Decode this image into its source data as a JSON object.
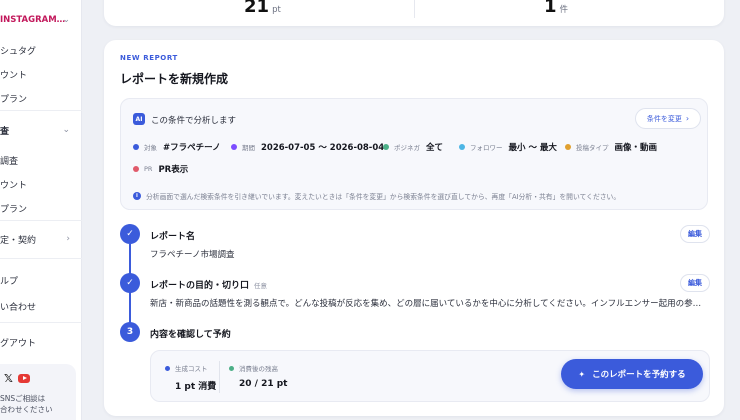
{
  "sidebar": {
    "brand": "INSTAGRAM…",
    "items": [
      {
        "label": "シュタグ"
      },
      {
        "label": "ウント"
      },
      {
        "label": "プラン"
      },
      {
        "label": "査"
      },
      {
        "label": "調査"
      },
      {
        "label": "ウント"
      },
      {
        "label": "プラン"
      },
      {
        "label": "定・契約"
      },
      {
        "label": "ルプ"
      },
      {
        "label": "い合わせ"
      },
      {
        "label": "グアウト"
      }
    ],
    "social": {
      "line1": "SNSご相談は",
      "line2": "合わせください"
    }
  },
  "stats": {
    "left": {
      "value": "21",
      "unit": "pt"
    },
    "right": {
      "value": "1",
      "unit": "件"
    }
  },
  "report": {
    "eyebrow": "NEW REPORT",
    "title": "レポートを新規作成",
    "conditions": {
      "ai_badge": "AI",
      "heading": "この条件で分析します",
      "change_label": "条件を変更",
      "chips": [
        {
          "label": "対象",
          "value": "#フラペチーノ",
          "color": "#3b5bdb"
        },
        {
          "label": "期間",
          "value": "2026-07-05 〜 2026-08-04",
          "color": "#7c4dff"
        },
        {
          "label": "ポジネガ",
          "value": "全て",
          "color": "#4caf87"
        },
        {
          "label": "フォロワー",
          "value": "最小 〜 最大",
          "color": "#4db6e5"
        },
        {
          "label": "投稿タイプ",
          "value": "画像・動画",
          "color": "#e0a030"
        },
        {
          "label": "PR",
          "value": "PR表示",
          "color": "#e05a6a"
        }
      ],
      "note": "分析画面で選んだ検索条件を引き継いでいます。変えたいときは「条件を変更」から検索条件を選び直してから、再度「AI分析・共有」を開いてください。"
    },
    "steps": [
      {
        "number": "✓",
        "title": "レポート名",
        "optional": "",
        "value": "フラペチーノ市場調査",
        "edit": "編集"
      },
      {
        "number": "✓",
        "title": "レポートの目的・切り口",
        "optional": "任意",
        "value": "新店・新商品の話題性を測る観点で。どんな投稿が反応を集め、どの層に届いているかを中心に分析してください。インフルエンサー起用の参…",
        "edit": "編集"
      },
      {
        "number": "3",
        "title": "内容を確認して予約"
      }
    ],
    "summary": {
      "cost_label": "生成コスト",
      "cost_value": "1 pt 消費",
      "balance_label": "消費後の残高",
      "balance_value": "20 / 21 pt",
      "reserve_label": "このレポートを予約する"
    }
  },
  "colors": {
    "accent": "#3b5bdb",
    "brand": "#c2185b"
  }
}
